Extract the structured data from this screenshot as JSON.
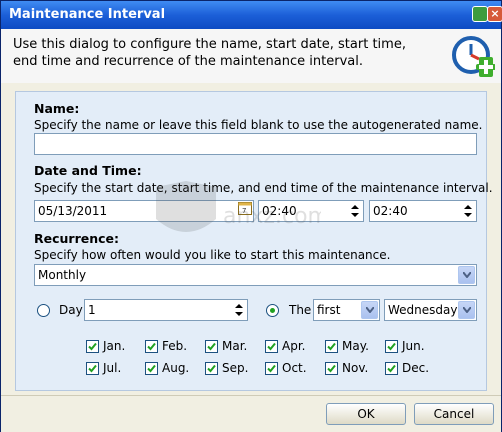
{
  "window": {
    "title": "Maintenance Interval"
  },
  "header": {
    "description": "Use this dialog to configure the name, start date, start time, end time and recurrence of the maintenance interval."
  },
  "name_section": {
    "heading": "Name:",
    "help": "Specify the name or leave this field blank to use the autogenerated name.",
    "value": ""
  },
  "datetime_section": {
    "heading": "Date and Time:",
    "help": "Specify the start date, start time, and end time of the maintenance interval.",
    "start_date": "05/13/2011",
    "start_time": "02:40",
    "end_time": "02:40"
  },
  "recurrence_section": {
    "heading": "Recurrence:",
    "help": "Specify how often would you like to start this maintenance.",
    "selected": "Monthly",
    "day_label": "Day",
    "day_value": "1",
    "the_label": "The",
    "ordinal": "first",
    "weekday": "Wednesday",
    "months": [
      "Jan.",
      "Feb.",
      "Mar.",
      "Apr.",
      "May.",
      "Jun.",
      "Jul.",
      "Aug.",
      "Sep.",
      "Oct.",
      "Nov.",
      "Dec."
    ]
  },
  "buttons": {
    "ok": "OK",
    "cancel": "Cancel"
  },
  "watermark": {
    "text": "anxz.com"
  }
}
